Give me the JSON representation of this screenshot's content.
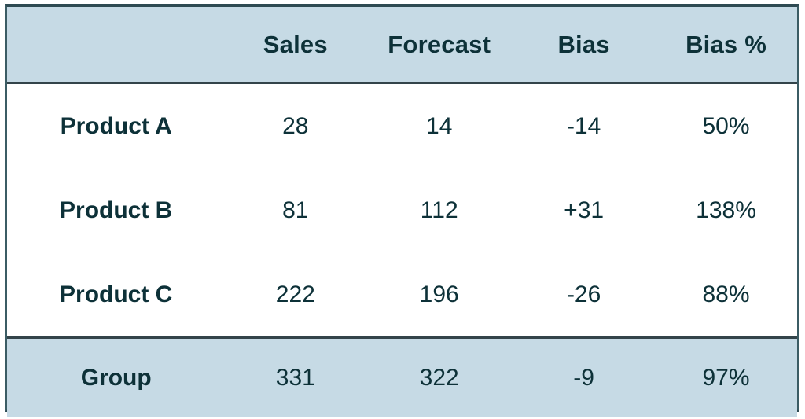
{
  "table": {
    "columns": [
      "",
      "Sales",
      "Forecast",
      "Bias",
      "Bias %"
    ],
    "header": {
      "label": "",
      "sales": "Sales",
      "forecast": "Forecast",
      "bias": "Bias",
      "bias_pct": "Bias %"
    },
    "rows": [
      {
        "label": "Product A",
        "sales": "28",
        "forecast": "14",
        "bias": "-14",
        "bias_pct": "50%"
      },
      {
        "label": "Product B",
        "sales": "81",
        "forecast": "112",
        "bias": "+31",
        "bias_pct": "138%"
      },
      {
        "label": "Product C",
        "sales": "222",
        "forecast": "196",
        "bias": "-26",
        "bias_pct": "88%"
      }
    ],
    "total": {
      "label": "Group",
      "sales": "331",
      "forecast": "322",
      "bias": "-9",
      "bias_pct": "97%"
    },
    "colors": {
      "header_background": "#c6dae5",
      "total_background": "#c6dae5",
      "body_background": "#ffffff",
      "text": "#0d3138",
      "border": "#2e4a52",
      "rule": "#33444a"
    }
  },
  "chart_data": {
    "type": "table",
    "title": "",
    "columns": [
      "",
      "Sales",
      "Forecast",
      "Bias",
      "Bias %"
    ],
    "rows": [
      [
        "Product A",
        28,
        14,
        -14,
        "50%"
      ],
      [
        "Product B",
        81,
        112,
        31,
        "138%"
      ],
      [
        "Product C",
        222,
        196,
        -26,
        "88%"
      ],
      [
        "Group",
        331,
        322,
        -9,
        "97%"
      ]
    ],
    "series": [
      {
        "name": "Sales",
        "categories": [
          "Product A",
          "Product B",
          "Product C",
          "Group"
        ],
        "values": [
          28,
          81,
          222,
          331
        ]
      },
      {
        "name": "Forecast",
        "categories": [
          "Product A",
          "Product B",
          "Product C",
          "Group"
        ],
        "values": [
          14,
          112,
          196,
          322
        ]
      },
      {
        "name": "Bias",
        "categories": [
          "Product A",
          "Product B",
          "Product C",
          "Group"
        ],
        "values": [
          -14,
          31,
          -26,
          -9
        ]
      },
      {
        "name": "Bias %",
        "categories": [
          "Product A",
          "Product B",
          "Product C",
          "Group"
        ],
        "values": [
          50,
          138,
          88,
          97
        ]
      }
    ]
  }
}
